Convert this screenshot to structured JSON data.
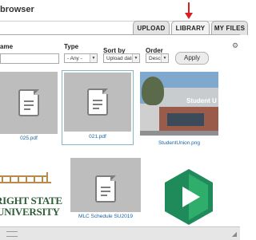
{
  "window": {
    "title": "browser"
  },
  "tabs": [
    {
      "label": "UPLOAD",
      "active": false
    },
    {
      "label": "LIBRARY",
      "active": true
    },
    {
      "label": "MY FILES",
      "active": false
    }
  ],
  "filters": {
    "name_label": "ame",
    "type_label": "Type",
    "type_value": "- Any -",
    "sort_label": "Sort by",
    "sort_value": "Upload date",
    "order_label": "Order",
    "order_value": "Desc",
    "apply_label": "Apply"
  },
  "files": [
    {
      "name": "025.pdf",
      "kind": "document-icon"
    },
    {
      "name": "021.pdf",
      "kind": "document-icon"
    },
    {
      "name": "StudentUnion.png",
      "kind": "photo"
    },
    {
      "name": "",
      "kind": "logo"
    },
    {
      "name": "MLC Schedule SU2019",
      "kind": "document-icon"
    },
    {
      "name": "",
      "kind": "app-icon"
    }
  ],
  "logo": {
    "line1": "RIGHT STATE",
    "line2": "UNIVERSITY"
  },
  "building_sign": "Student U",
  "colors": {
    "accent_arrow": "#d81e1e",
    "link": "#1565a6",
    "selection": "#86b7c9",
    "logo_green": "#2f5d39"
  }
}
